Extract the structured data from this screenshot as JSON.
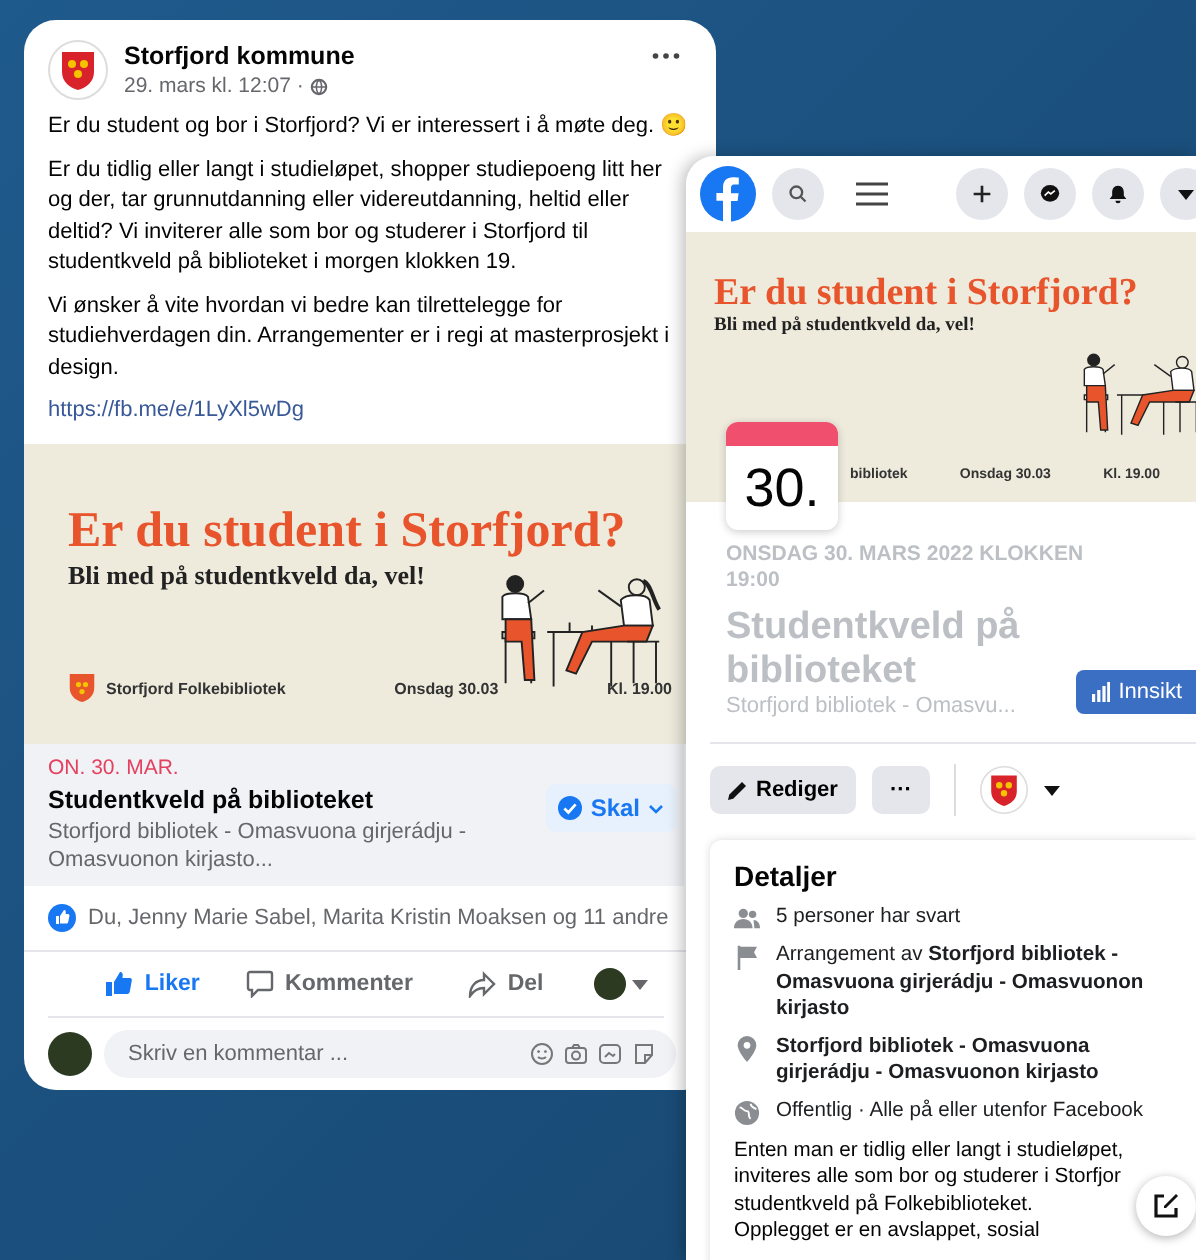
{
  "post": {
    "author": "Storfjord kommune",
    "time": "29. mars kl. 12:07 ·",
    "paragraphs": [
      "Er du student og bor i Storfjord? Vi er interessert i å møte deg. 🙂",
      "Er du tidlig eller langt i studieløpet, shopper studiepoeng litt her og der, tar grunnutdanning eller videreutdanning, heltid eller deltid? Vi inviterer alle som bor og studerer i Storfjord til studentkveld på biblioteket i morgen klokken 19.",
      "Vi ønsker å vite hvordan vi bedre kan tilrettelegge for studiehverdagen din. Arrangementer er i regi at masterprosjekt i design."
    ],
    "link": "https://fb.me/e/1LyXl5wDg",
    "banner": {
      "headline": "Er du student i Storfjord?",
      "subheadline": "Bli med på studentkveld da, vel!",
      "organizer": "Storfjord Folkebibliotek",
      "date": "Onsdag 30.03",
      "time": "Kl. 19.00"
    },
    "event": {
      "date": "ON. 30. MAR.",
      "title": "Studentkveld på biblioteket",
      "venue": "Storfjord bibliotek - Omasvuona girjerádju - Omasvuonon kirjasto...",
      "response": "Skal"
    },
    "reactions": "Du, Jenny Marie Sabel, Marita Kristin Moaksen og 11 andre",
    "actions": [
      {
        "kind": "like",
        "label": "Liker",
        "selected": true
      },
      {
        "kind": "comment",
        "label": "Kommenter",
        "selected": false
      },
      {
        "kind": "share",
        "label": "Del",
        "selected": false
      }
    ],
    "comment_placeholder": "Skriv en kommentar ..."
  },
  "event_page": {
    "banner": {
      "headline": "Er du student i Storfjord?",
      "subheadline": "Bli med på studentkveld da, vel!",
      "organizer": "bibliotek",
      "date": "Onsdag 30.03",
      "time": "Kl. 19.00"
    },
    "day": "30.",
    "datetime": "ONSDAG 30. MARS 2022 KLOKKEN 19:00",
    "title": "Studentkveld på biblioteket",
    "venue": "Storfjord bibliotek - Omasvu...",
    "insights": "Innsikt",
    "edit": "Rediger",
    "more": "···",
    "details": {
      "heading": "Detaljer",
      "items": [
        {
          "kind": "people",
          "text": "5 personer har svart"
        },
        {
          "kind": "host",
          "text": "Arrangement av **Storfjord bibliotek - Omasvuona girjerádju - Omasvuonon kirjasto**"
        },
        {
          "kind": "place",
          "text": "**Storfjord bibliotek - Omasvuona girjerádju - Omasvuonon kirjasto**"
        },
        {
          "kind": "public",
          "text": "Offentlig · Alle på eller utenfor Facebook"
        }
      ],
      "description_lines": [
        "Enten man er tidlig eller langt i studieløpet,",
        "inviteres alle som bor og studerer i Storfjor",
        "studentkveld på Folkebiblioteket.",
        "Opplegget er en avslappet, sosial"
      ]
    }
  }
}
